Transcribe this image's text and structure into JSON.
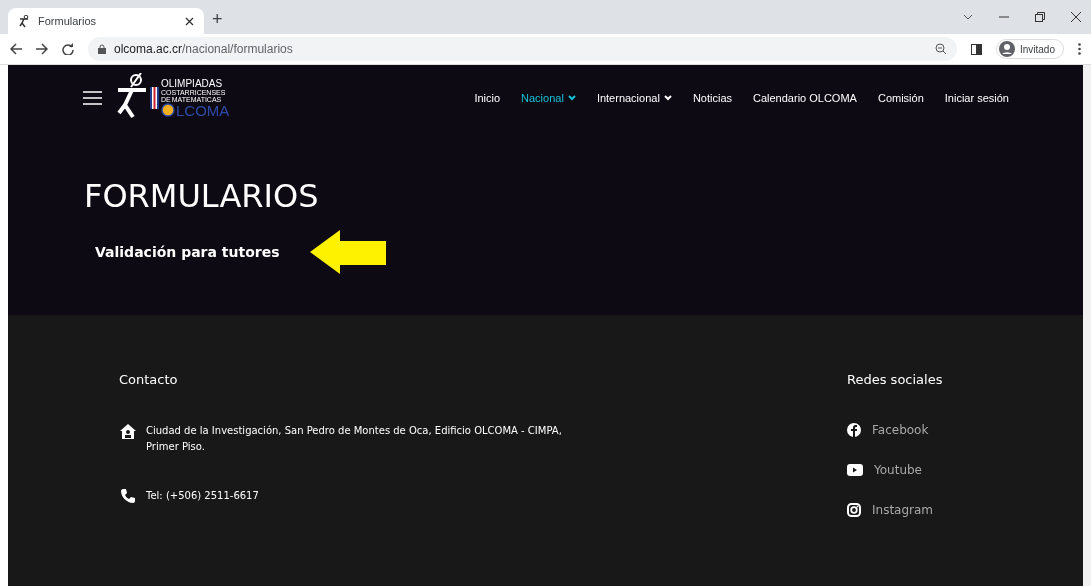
{
  "browser": {
    "tab": {
      "title": "Formularios",
      "selected": true
    },
    "new_tab": "+",
    "url_host": "olcoma.ac.cr",
    "url_path": "/nacional/formularios",
    "profile": "Invitado"
  },
  "header": {
    "logo": {
      "line_1": "OLIMPIADAS",
      "line_2": "COSTARRICENSES",
      "line_3": "DE",
      "line_4": "MATEMATICAS",
      "line_5": "LCOMA"
    },
    "nav": [
      {
        "label": "Inicio",
        "selected": false,
        "dropdown": false
      },
      {
        "label": "Nacional",
        "selected": true,
        "dropdown": true
      },
      {
        "label": "Internacional",
        "selected": false,
        "dropdown": true
      },
      {
        "label": "Noticias",
        "selected": false,
        "dropdown": false
      },
      {
        "label": "Calendario OLCOMA",
        "selected": false,
        "dropdown": false
      },
      {
        "label": "Comisión",
        "selected": false,
        "dropdown": false
      },
      {
        "label": "Iniciar sesión",
        "selected": false,
        "dropdown": false
      }
    ]
  },
  "hero": {
    "title": "FORMULARIOS",
    "link": "Validación para tutores"
  },
  "footer": {
    "contact": {
      "heading": "Contacto",
      "items": [
        {
          "kind": "address",
          "text": "Ciudad de la Investigación, San Pedro de Montes de Oca, Edificio OLCOMA - CIMPA, Primer Piso."
        },
        {
          "kind": "phone",
          "text": "Tel: (+506) 2511-6617"
        }
      ]
    },
    "social": {
      "heading": "Redes sociales",
      "items": [
        {
          "kind": "facebook",
          "label": "Facebook"
        },
        {
          "kind": "youtube",
          "label": "Youtube"
        },
        {
          "kind": "instagram",
          "label": "Instagram"
        }
      ]
    }
  }
}
